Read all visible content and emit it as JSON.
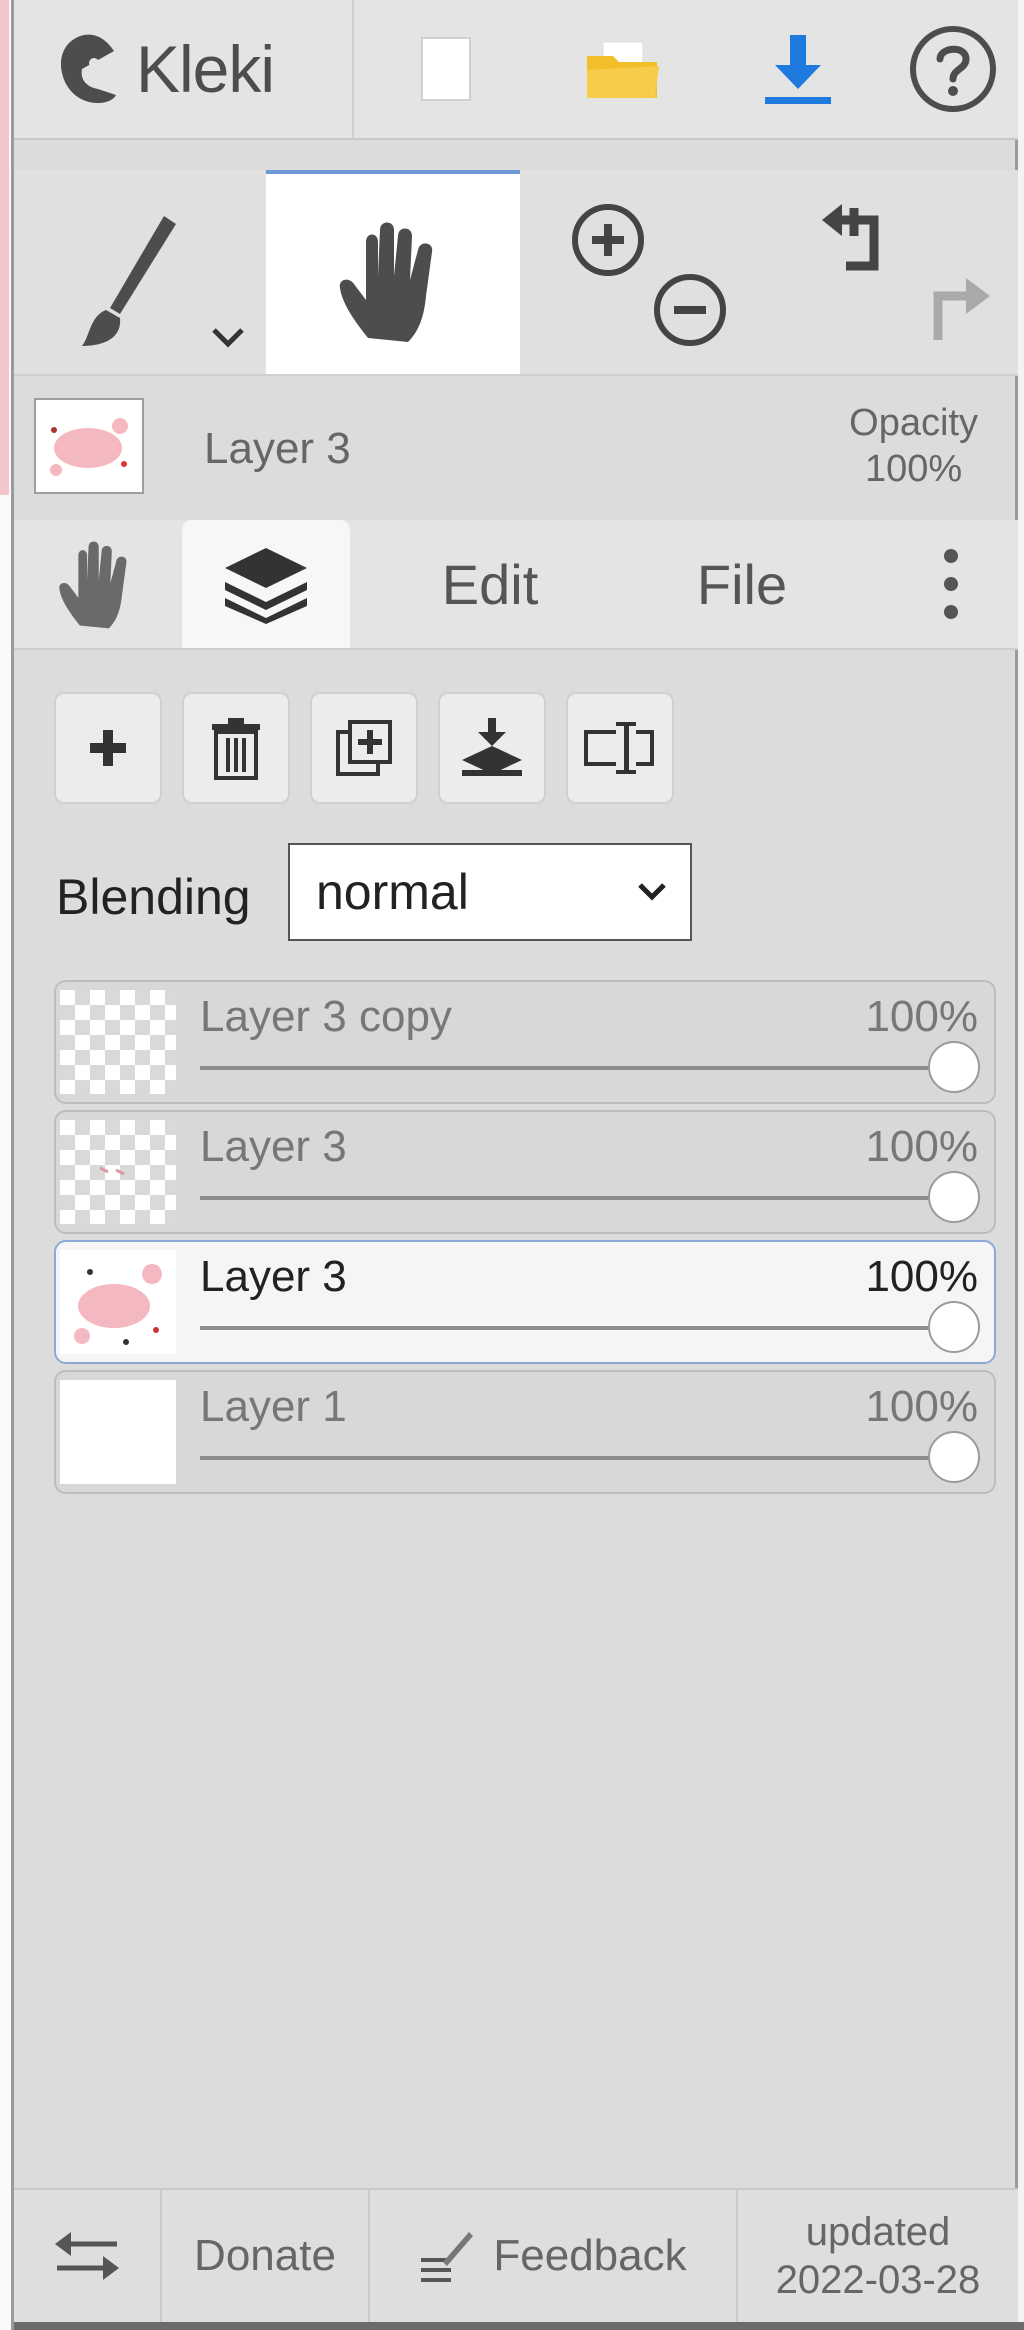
{
  "app": {
    "name": "Kleki"
  },
  "top_icons": [
    "new-image-icon",
    "open-folder-icon",
    "download-icon",
    "help-icon"
  ],
  "tools": [
    "brush-icon",
    "hand-icon",
    "zoom-in-icon",
    "zoom-out-icon",
    "undo-icon",
    "redo-icon"
  ],
  "current_layer": {
    "name": "Layer 3",
    "opacity_label": "Opacity",
    "opacity_value": "100%"
  },
  "tabs": [
    {
      "icon": "hand-icon"
    },
    {
      "icon": "layers-icon",
      "active": true
    },
    {
      "label": "Edit"
    },
    {
      "label": "File"
    },
    {
      "icon": "more-vertical-icon"
    }
  ],
  "layer_buttons": [
    "add-layer-icon",
    "delete-layer-icon",
    "duplicate-layer-icon",
    "merge-down-icon",
    "rename-layer-icon"
  ],
  "blending": {
    "label": "Blending",
    "value": "normal"
  },
  "layers": [
    {
      "name": "Layer 3 copy",
      "opacity": "100%",
      "opacity_value": 1.0,
      "thumb": "transparent"
    },
    {
      "name": "Layer 3",
      "opacity": "100%",
      "opacity_value": 1.0,
      "thumb": "transparent"
    },
    {
      "name": "Layer 3",
      "opacity": "100%",
      "opacity_value": 1.0,
      "thumb": "pink-art",
      "active": true
    },
    {
      "name": "Layer 1",
      "opacity": "100%",
      "opacity_value": 1.0,
      "thumb": "white"
    }
  ],
  "footer": {
    "swap_icon": "swap-arrows-icon",
    "donate": "Donate",
    "feedback": "Feedback",
    "updated_line1": "updated",
    "updated_line2": "2022-03-28"
  },
  "colors": {
    "accent": "#6d99d6",
    "download": "#1f7ae0",
    "folder": "#f2be2a",
    "canvas_pink": "#f4c6cc"
  }
}
